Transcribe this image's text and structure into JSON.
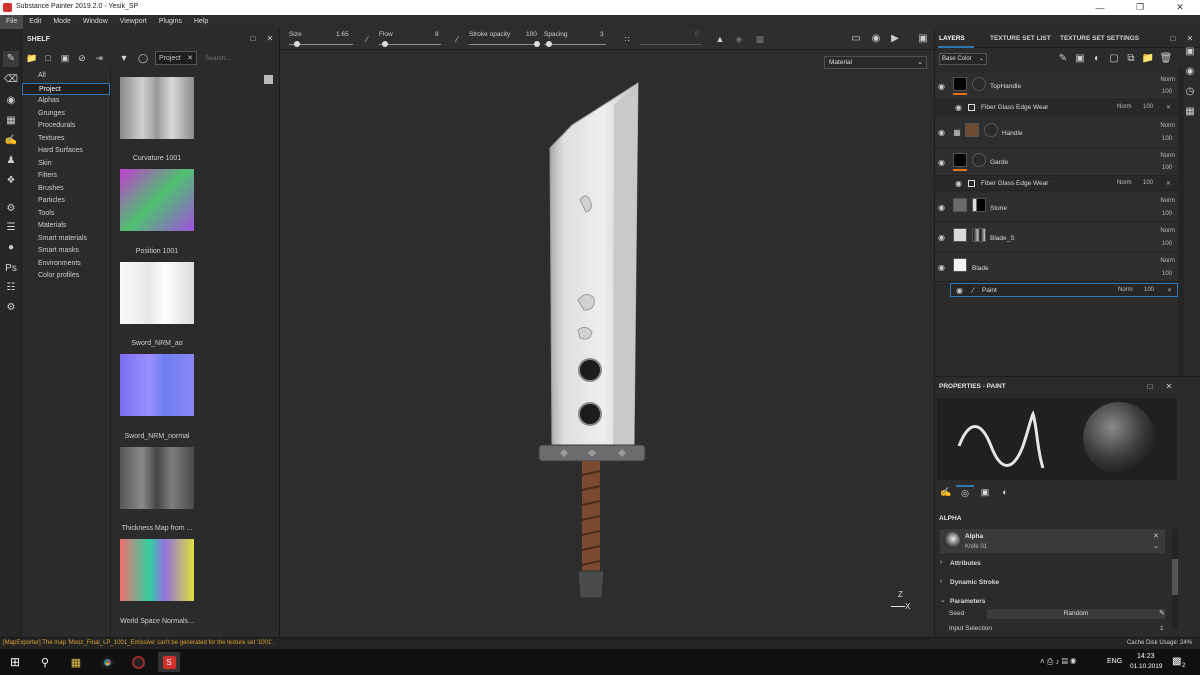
{
  "window": {
    "title": "Substance Painter 2019.2.0 - Yesik_SP"
  },
  "menu": [
    "File",
    "Edit",
    "Mode",
    "Window",
    "Viewport",
    "Plugins",
    "Help"
  ],
  "shelf": {
    "title": "SHELF",
    "filter_tag": "Project",
    "search_placeholder": "Search...",
    "categories": [
      "All",
      "Project",
      "Alphas",
      "Grunges",
      "Procedurals",
      "Textures",
      "Hard Surfaces",
      "Skin",
      "Filters",
      "Brushes",
      "Particles",
      "Tools",
      "Materials",
      "Smart materials",
      "Smart masks",
      "Environments",
      "Color profiles"
    ],
    "selected_category": "Project",
    "items": [
      "Curvature 1001",
      "Position 1001",
      "Sword_NRM_ao",
      "Sword_NRM_normal",
      "Thickness Map from ...",
      "World Space Normals..."
    ]
  },
  "toolbar": {
    "size_label": "Size",
    "size_value": "1.65",
    "flow_label": "Flow",
    "flow_value": "8",
    "opacity_label": "Stroke opacity",
    "opacity_value": "100",
    "spacing_label": "Spacing",
    "spacing_value": "3",
    "jitter_value": "0"
  },
  "viewport": {
    "material_mode": "Material",
    "axis_z": "Z",
    "axis_x": "X"
  },
  "layers_panel": {
    "tabs": [
      "LAYERS",
      "TEXTURE SET LIST",
      "TEXTURE SET SETTINGS"
    ],
    "channel": "Base Color",
    "layers": [
      {
        "name": "TopHandle",
        "blend": "Norm",
        "opacity": "100",
        "effect": {
          "name": "Fiber Glass Edge Wear",
          "blend": "Norm",
          "opacity": "100"
        }
      },
      {
        "name": "Handle",
        "blend": "Norm",
        "opacity": "100"
      },
      {
        "name": "Garde",
        "blend": "Norm",
        "opacity": "100",
        "effect": {
          "name": "Fiber Glass Edge Wear",
          "blend": "Norm",
          "opacity": "100"
        }
      },
      {
        "name": "Stone",
        "blend": "Norm",
        "opacity": "100"
      },
      {
        "name": "Blade_S",
        "blend": "Norm",
        "opacity": "100"
      },
      {
        "name": "Blade",
        "blend": "Norm",
        "opacity": "100",
        "effect": {
          "name": "Paint",
          "blend": "Norm",
          "opacity": "100"
        }
      }
    ]
  },
  "properties": {
    "title": "PROPERTIES - PAINT",
    "alpha_section": "ALPHA",
    "alpha_name": "Alpha",
    "alpha_resource": "Knife 01",
    "attributes": "Attributes",
    "dynamic_stroke": "Dynamic Stroke",
    "parameters": "Parameters",
    "seed_label": "Seed",
    "seed_value": "Random",
    "input_selection_label": "Input Selection",
    "input_selection_value": "1"
  },
  "status": {
    "message": "[MapExporter] The map 'Mooz_Final_LP_1001_Emissive' can't be generated for the texture set '1001'.",
    "cache": "Cache Disk Usage:  24%"
  },
  "taskbar": {
    "lang": "ENG",
    "time": "14:23",
    "date": "01.10.2019",
    "notifications": "2"
  },
  "colors": {
    "accent": "#2f78b3",
    "warning": "#e0a030",
    "opacity_bar": "#e0761c"
  }
}
